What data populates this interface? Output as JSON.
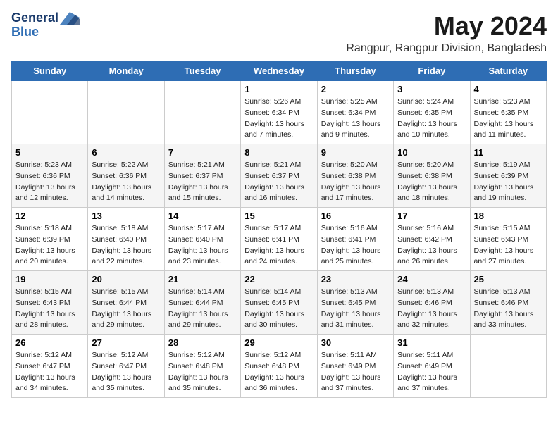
{
  "logo": {
    "general": "General",
    "blue": "Blue",
    "tagline": ""
  },
  "title": "May 2024",
  "location": "Rangpur, Rangpur Division, Bangladesh",
  "days_of_week": [
    "Sunday",
    "Monday",
    "Tuesday",
    "Wednesday",
    "Thursday",
    "Friday",
    "Saturday"
  ],
  "weeks": [
    [
      {
        "day": "",
        "info": ""
      },
      {
        "day": "",
        "info": ""
      },
      {
        "day": "",
        "info": ""
      },
      {
        "day": "1",
        "info": "Sunrise: 5:26 AM\nSunset: 6:34 PM\nDaylight: 13 hours\nand 7 minutes."
      },
      {
        "day": "2",
        "info": "Sunrise: 5:25 AM\nSunset: 6:34 PM\nDaylight: 13 hours\nand 9 minutes."
      },
      {
        "day": "3",
        "info": "Sunrise: 5:24 AM\nSunset: 6:35 PM\nDaylight: 13 hours\nand 10 minutes."
      },
      {
        "day": "4",
        "info": "Sunrise: 5:23 AM\nSunset: 6:35 PM\nDaylight: 13 hours\nand 11 minutes."
      }
    ],
    [
      {
        "day": "5",
        "info": "Sunrise: 5:23 AM\nSunset: 6:36 PM\nDaylight: 13 hours\nand 12 minutes."
      },
      {
        "day": "6",
        "info": "Sunrise: 5:22 AM\nSunset: 6:36 PM\nDaylight: 13 hours\nand 14 minutes."
      },
      {
        "day": "7",
        "info": "Sunrise: 5:21 AM\nSunset: 6:37 PM\nDaylight: 13 hours\nand 15 minutes."
      },
      {
        "day": "8",
        "info": "Sunrise: 5:21 AM\nSunset: 6:37 PM\nDaylight: 13 hours\nand 16 minutes."
      },
      {
        "day": "9",
        "info": "Sunrise: 5:20 AM\nSunset: 6:38 PM\nDaylight: 13 hours\nand 17 minutes."
      },
      {
        "day": "10",
        "info": "Sunrise: 5:20 AM\nSunset: 6:38 PM\nDaylight: 13 hours\nand 18 minutes."
      },
      {
        "day": "11",
        "info": "Sunrise: 5:19 AM\nSunset: 6:39 PM\nDaylight: 13 hours\nand 19 minutes."
      }
    ],
    [
      {
        "day": "12",
        "info": "Sunrise: 5:18 AM\nSunset: 6:39 PM\nDaylight: 13 hours\nand 20 minutes."
      },
      {
        "day": "13",
        "info": "Sunrise: 5:18 AM\nSunset: 6:40 PM\nDaylight: 13 hours\nand 22 minutes."
      },
      {
        "day": "14",
        "info": "Sunrise: 5:17 AM\nSunset: 6:40 PM\nDaylight: 13 hours\nand 23 minutes."
      },
      {
        "day": "15",
        "info": "Sunrise: 5:17 AM\nSunset: 6:41 PM\nDaylight: 13 hours\nand 24 minutes."
      },
      {
        "day": "16",
        "info": "Sunrise: 5:16 AM\nSunset: 6:41 PM\nDaylight: 13 hours\nand 25 minutes."
      },
      {
        "day": "17",
        "info": "Sunrise: 5:16 AM\nSunset: 6:42 PM\nDaylight: 13 hours\nand 26 minutes."
      },
      {
        "day": "18",
        "info": "Sunrise: 5:15 AM\nSunset: 6:43 PM\nDaylight: 13 hours\nand 27 minutes."
      }
    ],
    [
      {
        "day": "19",
        "info": "Sunrise: 5:15 AM\nSunset: 6:43 PM\nDaylight: 13 hours\nand 28 minutes."
      },
      {
        "day": "20",
        "info": "Sunrise: 5:15 AM\nSunset: 6:44 PM\nDaylight: 13 hours\nand 29 minutes."
      },
      {
        "day": "21",
        "info": "Sunrise: 5:14 AM\nSunset: 6:44 PM\nDaylight: 13 hours\nand 29 minutes."
      },
      {
        "day": "22",
        "info": "Sunrise: 5:14 AM\nSunset: 6:45 PM\nDaylight: 13 hours\nand 30 minutes."
      },
      {
        "day": "23",
        "info": "Sunrise: 5:13 AM\nSunset: 6:45 PM\nDaylight: 13 hours\nand 31 minutes."
      },
      {
        "day": "24",
        "info": "Sunrise: 5:13 AM\nSunset: 6:46 PM\nDaylight: 13 hours\nand 32 minutes."
      },
      {
        "day": "25",
        "info": "Sunrise: 5:13 AM\nSunset: 6:46 PM\nDaylight: 13 hours\nand 33 minutes."
      }
    ],
    [
      {
        "day": "26",
        "info": "Sunrise: 5:12 AM\nSunset: 6:47 PM\nDaylight: 13 hours\nand 34 minutes."
      },
      {
        "day": "27",
        "info": "Sunrise: 5:12 AM\nSunset: 6:47 PM\nDaylight: 13 hours\nand 35 minutes."
      },
      {
        "day": "28",
        "info": "Sunrise: 5:12 AM\nSunset: 6:48 PM\nDaylight: 13 hours\nand 35 minutes."
      },
      {
        "day": "29",
        "info": "Sunrise: 5:12 AM\nSunset: 6:48 PM\nDaylight: 13 hours\nand 36 minutes."
      },
      {
        "day": "30",
        "info": "Sunrise: 5:11 AM\nSunset: 6:49 PM\nDaylight: 13 hours\nand 37 minutes."
      },
      {
        "day": "31",
        "info": "Sunrise: 5:11 AM\nSunset: 6:49 PM\nDaylight: 13 hours\nand 37 minutes."
      },
      {
        "day": "",
        "info": ""
      }
    ]
  ]
}
